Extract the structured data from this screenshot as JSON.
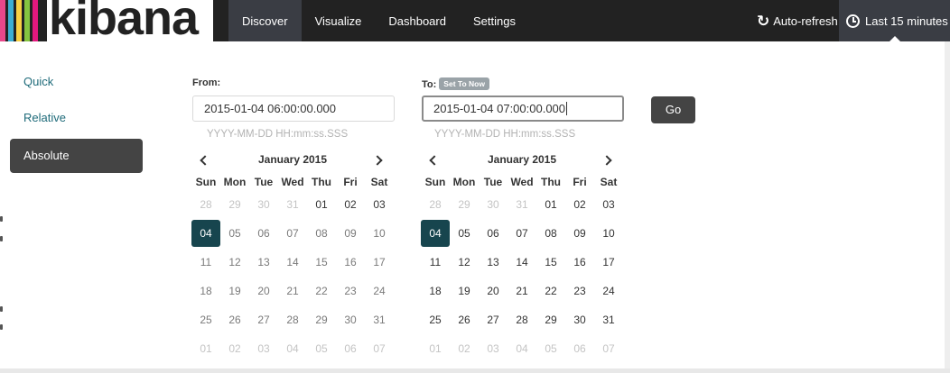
{
  "brand": {
    "logo_text": "kibana",
    "stripe_colors": [
      "#e8488b",
      "#3caed2",
      "#f8d042",
      "#85c440",
      "#e2187e"
    ]
  },
  "nav": {
    "items": [
      {
        "label": "Discover",
        "active": true
      },
      {
        "label": "Visualize",
        "active": false
      },
      {
        "label": "Dashboard",
        "active": false
      },
      {
        "label": "Settings",
        "active": false
      }
    ]
  },
  "header": {
    "autorefresh_label": "Auto-refresh",
    "time_label": "Last 15 minutes"
  },
  "modes": [
    {
      "label": "Quick",
      "active": false
    },
    {
      "label": "Relative",
      "active": false
    },
    {
      "label": "Absolute",
      "active": true
    }
  ],
  "from": {
    "label": "From:",
    "value": "2015-01-04 06:00:00.000",
    "format_hint": "YYYY-MM-DD HH:mm:ss.SSS",
    "calendar": {
      "month_title": "January 2015"
    }
  },
  "to": {
    "label": "To:",
    "set_to_now_label": "Set To Now",
    "value": "2015-01-04 07:00:00.000",
    "format_hint": "YYYY-MM-DD HH:mm:ss.SSS",
    "calendar": {
      "month_title": "January 2015"
    }
  },
  "go_label": "Go",
  "weekdays": [
    "Sun",
    "Mon",
    "Tue",
    "Wed",
    "Thu",
    "Fri",
    "Sat"
  ],
  "weeks": [
    [
      "28",
      "29",
      "30",
      "31",
      "01",
      "02",
      "03"
    ],
    [
      "04",
      "05",
      "06",
      "07",
      "08",
      "09",
      "10"
    ],
    [
      "11",
      "12",
      "13",
      "14",
      "15",
      "16",
      "17"
    ],
    [
      "18",
      "19",
      "20",
      "21",
      "22",
      "23",
      "24"
    ],
    [
      "25",
      "26",
      "27",
      "28",
      "29",
      "30",
      "31"
    ],
    [
      "01",
      "02",
      "03",
      "04",
      "05",
      "06",
      "07"
    ]
  ],
  "selected_day": "04",
  "colors": {
    "accent_selected": "#17454e",
    "link": "#1f6b7a",
    "topbar": "#222222"
  }
}
